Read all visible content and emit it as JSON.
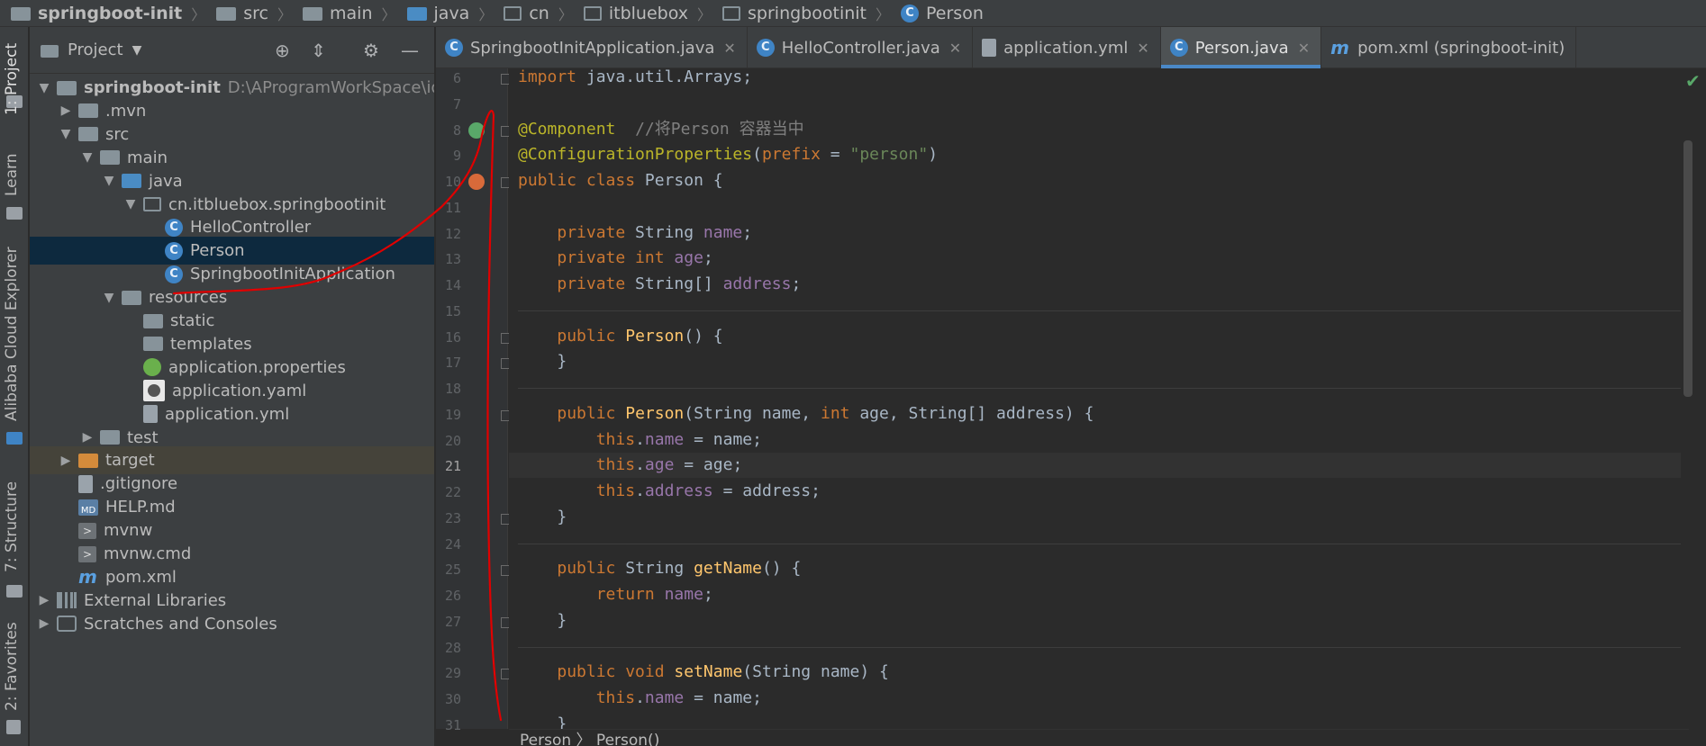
{
  "breadcrumb": [
    "springboot-init",
    "src",
    "main",
    "java",
    "cn",
    "itbluebox",
    "springbootinit",
    "Person"
  ],
  "left_strip": {
    "project": "1: Project",
    "learn": "Learn",
    "alibaba": "Alibaba Cloud Explorer",
    "structure": "7: Structure",
    "favorites": "2: Favorites"
  },
  "project_panel": {
    "title": "Project",
    "tree": [
      {
        "label": "springboot-init",
        "path": "D:\\AProgramWorkSpace\\idea\\s",
        "depth": 0,
        "arrow": "▼",
        "icon": "module"
      },
      {
        "label": ".mvn",
        "depth": 1,
        "arrow": "▶",
        "icon": "folder"
      },
      {
        "label": "src",
        "depth": 1,
        "arrow": "▼",
        "icon": "folder"
      },
      {
        "label": "main",
        "depth": 2,
        "arrow": "▼",
        "icon": "folder"
      },
      {
        "label": "java",
        "depth": 3,
        "arrow": "▼",
        "icon": "src-folder"
      },
      {
        "label": "cn.itbluebox.springbootinit",
        "depth": 4,
        "arrow": "▼",
        "icon": "package"
      },
      {
        "label": "HelloController",
        "depth": 5,
        "arrow": "",
        "icon": "class"
      },
      {
        "label": "Person",
        "depth": 5,
        "arrow": "",
        "icon": "class",
        "selected": true
      },
      {
        "label": "SpringbootInitApplication",
        "depth": 5,
        "arrow": "",
        "icon": "class-app"
      },
      {
        "label": "resources",
        "depth": 3,
        "arrow": "▼",
        "icon": "folder"
      },
      {
        "label": "static",
        "depth": 4,
        "arrow": "",
        "icon": "folder"
      },
      {
        "label": "templates",
        "depth": 4,
        "arrow": "",
        "icon": "folder"
      },
      {
        "label": "application.properties",
        "depth": 4,
        "arrow": "",
        "icon": "spring"
      },
      {
        "label": "application.yaml",
        "depth": 4,
        "arrow": "",
        "icon": "yaml"
      },
      {
        "label": "application.yml",
        "depth": 4,
        "arrow": "",
        "icon": "file"
      },
      {
        "label": "test",
        "depth": 2,
        "arrow": "▶",
        "icon": "folder"
      },
      {
        "label": "target",
        "depth": 1,
        "arrow": "▶",
        "icon": "target-folder",
        "highlight": true
      },
      {
        "label": ".gitignore",
        "depth": 1,
        "arrow": "",
        "icon": "file"
      },
      {
        "label": "HELP.md",
        "depth": 1,
        "arrow": "",
        "icon": "md"
      },
      {
        "label": "mvnw",
        "depth": 1,
        "arrow": "",
        "icon": "cmd"
      },
      {
        "label": "mvnw.cmd",
        "depth": 1,
        "arrow": "",
        "icon": "cmd"
      },
      {
        "label": "pom.xml",
        "depth": 1,
        "arrow": "",
        "icon": "maven"
      },
      {
        "label": "External Libraries",
        "depth": 0,
        "arrow": "▶",
        "icon": "lib"
      },
      {
        "label": "Scratches and Consoles",
        "depth": 0,
        "arrow": "▶",
        "icon": "scratch"
      }
    ]
  },
  "tabs": [
    {
      "label": "SpringbootInitApplication.java",
      "icon": "class-app",
      "active": false
    },
    {
      "label": "HelloController.java",
      "icon": "class",
      "active": false
    },
    {
      "label": "application.yml",
      "icon": "file",
      "active": false
    },
    {
      "label": "Person.java",
      "icon": "class",
      "active": true
    },
    {
      "label": "pom.xml (springboot-init)",
      "icon": "maven",
      "active": false
    }
  ],
  "editor": {
    "current_line": 21,
    "lines": [
      {
        "n": 6,
        "html": "<span class=\"kw\">import</span> java.util.Arrays;"
      },
      {
        "n": 7,
        "html": ""
      },
      {
        "n": 8,
        "html": "<span class=\"an\">@Component</span>  <span class=\"cm\">//将Person 容器当中</span>"
      },
      {
        "n": 9,
        "html": "<span class=\"an\">@ConfigurationProperties</span>(<span class=\"kw\">prefix</span> = <span class=\"str\">\"person\"</span>)"
      },
      {
        "n": 10,
        "html": "<span class=\"kw\">public class</span> Person {"
      },
      {
        "n": 11,
        "html": ""
      },
      {
        "n": 12,
        "html": "    <span class=\"kw\">private</span> String <span class=\"fld\">name</span>;"
      },
      {
        "n": 13,
        "html": "    <span class=\"kw\">private int</span> <span class=\"fld\">age</span>;"
      },
      {
        "n": 14,
        "html": "    <span class=\"kw\">private</span> String[] <span class=\"fld\">address</span>;"
      },
      {
        "n": 15,
        "html": ""
      },
      {
        "n": 16,
        "html": "    <span class=\"kw\">public</span> <span class=\"mth\">Person</span>() {"
      },
      {
        "n": 17,
        "html": "    }"
      },
      {
        "n": 18,
        "html": ""
      },
      {
        "n": 19,
        "html": "    <span class=\"kw\">public</span> <span class=\"mth\">Person</span>(String name, <span class=\"kw\">int</span> age, String[] address) {"
      },
      {
        "n": 20,
        "html": "        <span class=\"kw\">this</span>.<span class=\"fld\">name</span> = name;"
      },
      {
        "n": 21,
        "html": "        <span class=\"kw\">this</span>.<span class=\"fld\">age</span> = age;"
      },
      {
        "n": 22,
        "html": "        <span class=\"kw\">this</span>.<span class=\"fld\">address</span> = address;"
      },
      {
        "n": 23,
        "html": "    }"
      },
      {
        "n": 24,
        "html": ""
      },
      {
        "n": 25,
        "html": "    <span class=\"kw\">public</span> String <span class=\"mth\">getName</span>() {"
      },
      {
        "n": 26,
        "html": "        <span class=\"kw\">return</span> <span class=\"fld\">name</span>;"
      },
      {
        "n": 27,
        "html": "    }"
      },
      {
        "n": 28,
        "html": ""
      },
      {
        "n": 29,
        "html": "    <span class=\"kw\">public void</span> <span class=\"mth\">setName</span>(String name) {"
      },
      {
        "n": 30,
        "html": "        <span class=\"kw\">this</span>.<span class=\"fld\">name</span> = name;"
      },
      {
        "n": 31,
        "html": "    }"
      }
    ]
  },
  "bottom_breadcrumb": "Person  〉 Person()",
  "colors": {
    "keyword": "#cc7832",
    "annotation": "#bbb529",
    "comment": "#808080",
    "string": "#6a8759",
    "field": "#9876aa",
    "method": "#ffc66d",
    "tab_accent": "#4a88c7",
    "selection": "#0d293e",
    "annotation_ink": "#e00000"
  }
}
